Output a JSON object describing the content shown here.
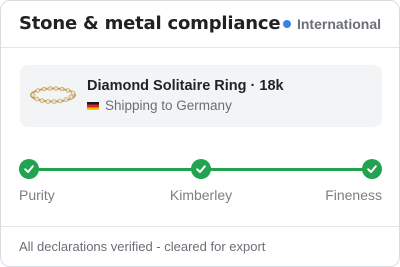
{
  "header": {
    "title": "Stone & metal compliance",
    "status_label": "International",
    "status_color": "#3b82e6"
  },
  "product": {
    "thumbnail_icon": "ring-band-icon",
    "name": "Diamond Solitaire Ring · 18k",
    "flag_icon": "germany-flag-icon",
    "shipping": "Shipping to Germany"
  },
  "steps": [
    {
      "label": "Purity",
      "state": "complete"
    },
    {
      "label": "Kimberley",
      "state": "complete"
    },
    {
      "label": "Fineness",
      "state": "complete"
    }
  ],
  "footer": {
    "message": "All declarations verified - cleared for export"
  },
  "colors": {
    "accent_green": "#22a350",
    "status_blue": "#3b82e6"
  }
}
